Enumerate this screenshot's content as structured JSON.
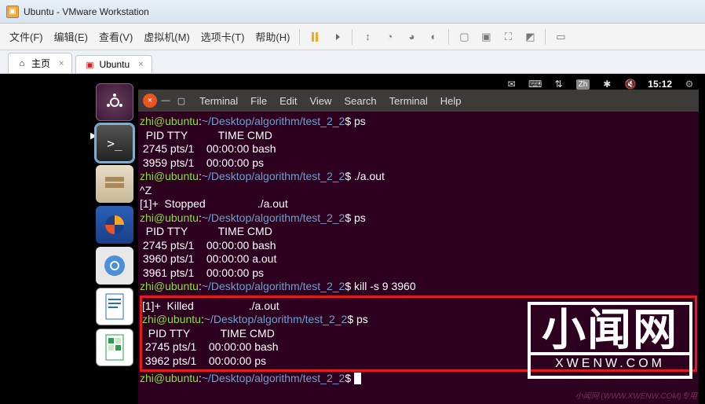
{
  "window": {
    "title": "Ubuntu - VMware Workstation"
  },
  "menu": {
    "file": "文件(F)",
    "edit": "编辑(E)",
    "view": "查看(V)",
    "vm": "虚拟机(M)",
    "tabs": "选项卡(T)",
    "help": "帮助(H)"
  },
  "tabs": {
    "home": "主页",
    "ubuntu": "Ubuntu"
  },
  "gnome": {
    "lang": "Zh",
    "clock": "15:12"
  },
  "terminal": {
    "menus": {
      "terminal1": "Terminal",
      "file": "File",
      "edit": "Edit",
      "view": "View",
      "search": "Search",
      "terminal2": "Terminal",
      "help": "Help"
    },
    "user": "zhi@ubuntu",
    "path": "~/Desktop/algorithm/test_2_2",
    "lines": {
      "cmd_ps1": "ps",
      "hdr": "  PID TTY          TIME CMD",
      "l1": " 2745 pts/1    00:00:00 bash",
      "l2": " 3959 pts/1    00:00:00 ps",
      "cmd_aout": "./a.out",
      "ctrlz": "^Z",
      "stopped": "[1]+  Stopped                 ./a.out",
      "cmd_ps2": "ps",
      "l3": " 2745 pts/1    00:00:00 bash",
      "l4": " 3960 pts/1    00:00:00 a.out",
      "l5": " 3961 pts/1    00:00:00 ps",
      "cmd_kill": "kill -s 9 3960",
      "killed": "[1]+  Killed                  ./a.out",
      "cmd_ps3": "ps",
      "l6": " 2745 pts/1    00:00:00 bash",
      "l7": " 3962 pts/1    00:00:00 ps"
    }
  },
  "watermark": {
    "text": "小闻网",
    "sub": "XWENW.COM",
    "foot": "小闻网 (WWW.XWENW.COM)专用"
  }
}
